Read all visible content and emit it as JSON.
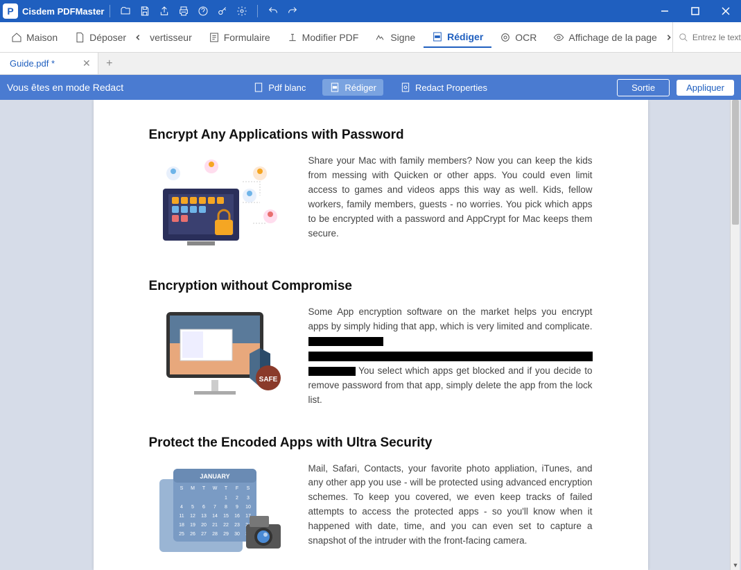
{
  "titlebar": {
    "appname": "Cisdem PDFMaster"
  },
  "toolbar": {
    "items": [
      {
        "label": "Maison"
      },
      {
        "label": "Déposer"
      },
      {
        "label": "vertisseur"
      },
      {
        "label": "Formulaire"
      },
      {
        "label": "Modifier PDF"
      },
      {
        "label": "Signe"
      },
      {
        "label": "Rédiger"
      },
      {
        "label": "OCR"
      },
      {
        "label": "Affichage de la page"
      }
    ],
    "search_placeholder": "Entrez le texte de l..."
  },
  "tabs": {
    "file": "Guide.pdf *"
  },
  "modebar": {
    "status": "Vous êtes en mode Redact",
    "blank": "Pdf blanc",
    "redact": "Rédiger",
    "props": "Redact Properties",
    "exit": "Sortie",
    "apply": "Appliquer"
  },
  "doc": {
    "s1": {
      "title": "Encrypt Any Applications with Password",
      "body": "Share your Mac with family members? Now you can keep the kids from messing with Quicken or other apps. You could even limit access to games and videos apps this way as well. Kids, fellow workers, family members, guests - no worries. You pick which apps to be encrypted with a password and AppCrypt for Mac keeps them secure."
    },
    "s2": {
      "title": "Encryption without Compromise",
      "body1": "Some App encryption software on the market helps you encrypt apps by simply hiding that app, which is very limited and complicate. ",
      "body2": " You select which apps get blocked and if you decide to remove password from that app, simply delete the app from the lock list."
    },
    "s3": {
      "title": "Protect the Encoded Apps with Ultra Security",
      "body": "Mail, Safari, Contacts, your favorite photo appliation, iTunes, and any other app you use - will be protected using advanced encryption schemes. To keep you covered, we even keep tracks of failed attempts to access the protected apps - so you'll know when it happened with date, time, and you can even set to capture a snapshot of the intruder with the front-facing camera."
    }
  }
}
